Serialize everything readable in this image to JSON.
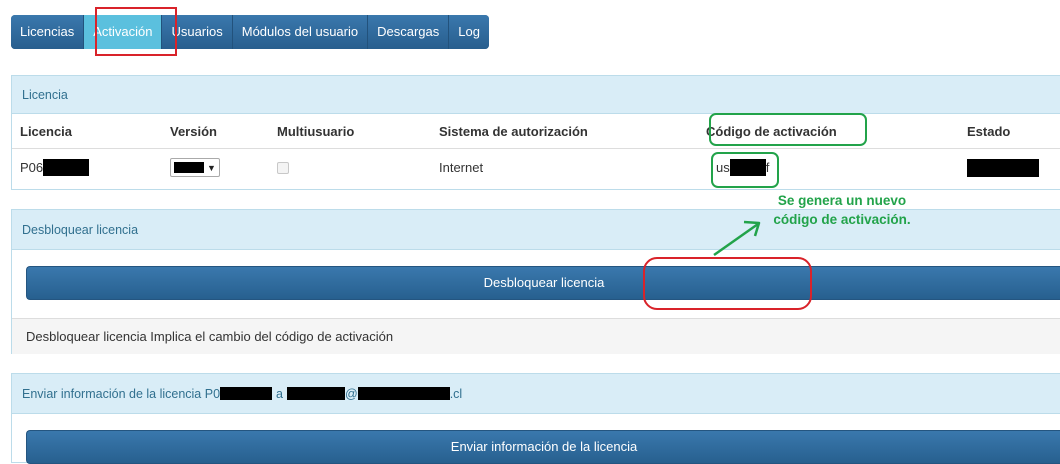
{
  "tabs": [
    {
      "label": "Licencias",
      "active": false
    },
    {
      "label": "Activación",
      "active": true
    },
    {
      "label": "Usuarios",
      "active": false
    },
    {
      "label": "Módulos del usuario",
      "active": false
    },
    {
      "label": "Descargas",
      "active": false
    },
    {
      "label": "Log",
      "active": false
    }
  ],
  "licencia_panel": {
    "heading": "Licencia",
    "columns": [
      "Licencia",
      "Versión",
      "Multiusuario",
      "Sistema de autorización",
      "Código de activación",
      "Estado"
    ],
    "row": {
      "licencia_prefix": "P06",
      "multiusuario_checked": false,
      "sistema": "Internet",
      "codigo_prefix": "us",
      "codigo_suffix": "f"
    }
  },
  "unlock_panel": {
    "heading": "Desbloquear licencia",
    "button_label": "Desbloquear licencia",
    "note": "Desbloquear licencia Implica el cambio del código de activación"
  },
  "send_panel": {
    "heading_prefix": "Enviar información de la licencia P0",
    "heading_a": "a",
    "heading_at": "@",
    "heading_domain": ".cl",
    "button_label": "Enviar información de la licencia"
  },
  "annotation": {
    "line1": "Se genera un nuevo",
    "line2": "código de activación."
  },
  "colors": {
    "tab_bg": "#2f6da3",
    "tab_active": "#5bc0de",
    "panel_heading_bg": "#d9edf7",
    "panel_heading_text": "#31708f",
    "highlight_red": "#d9232a",
    "highlight_green": "#22a34a"
  }
}
